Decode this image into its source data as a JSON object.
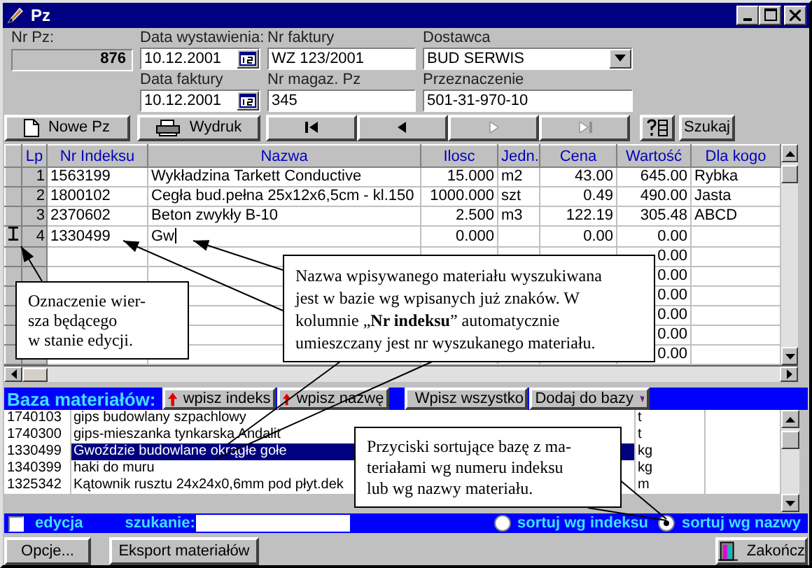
{
  "window": {
    "title": "Pz"
  },
  "nr_pz": {
    "label": "Nr Pz:",
    "value": "876"
  },
  "fields": [
    {
      "label": "Data wystawienia:",
      "value": "10.12.2001",
      "kind": "date"
    },
    {
      "label": "Nr faktury",
      "value": "WZ 123/2001",
      "kind": "text"
    },
    {
      "label": "Dostawca",
      "value": "BUD SERWIS",
      "kind": "combo"
    },
    {
      "label": "Data faktury",
      "value": "10.12.2001",
      "kind": "date"
    },
    {
      "label": "Nr magaz. Pz",
      "value": "345",
      "kind": "text"
    },
    {
      "label": "Przeznaczenie",
      "value": "501-31-970-10",
      "kind": "text"
    }
  ],
  "toolbar": [
    {
      "kind": "new",
      "label": "Nowe Pz"
    },
    {
      "kind": "print",
      "label": "Wydruk"
    },
    {
      "kind": "first",
      "disabled": false
    },
    {
      "kind": "prev",
      "disabled": false
    },
    {
      "kind": "next",
      "disabled": true
    },
    {
      "kind": "last",
      "disabled": true
    },
    {
      "kind": "list"
    },
    {
      "kind": "text",
      "label": "Szukaj"
    }
  ],
  "table": {
    "columns": [
      "Lp",
      "Nr Indeksu",
      "Nazwa",
      "Ilosc",
      "Jedn.",
      "Cena",
      "Wartość",
      "Dla kogo"
    ],
    "rows": [
      {
        "editing": false,
        "cells": [
          "1",
          "1563199",
          "Wykładzina Tarkett Conductive",
          "15.000",
          "m2",
          "43.00",
          "645.00",
          "Rybka"
        ]
      },
      {
        "editing": false,
        "cells": [
          "2",
          "1800102",
          "Cegła bud.pełna 25x12x6,5cm - kl.150",
          "1000.000",
          "szt",
          "0.49",
          "490.00",
          "Jasta"
        ]
      },
      {
        "editing": false,
        "cells": [
          "3",
          "2370602",
          "Beton zwykły B-10",
          "2.500",
          "m3",
          "122.19",
          "305.48",
          "ABCD"
        ]
      },
      {
        "editing": true,
        "cells": [
          "4",
          "1330499",
          "Gw",
          "0.000",
          "",
          "0.00",
          "0.00",
          ""
        ]
      },
      {
        "editing": false,
        "cells": [
          "",
          "",
          "",
          "",
          "",
          "",
          "0.00",
          ""
        ]
      },
      {
        "editing": false,
        "cells": [
          "",
          "",
          "",
          "",
          "",
          "",
          "0.00",
          ""
        ]
      },
      {
        "editing": false,
        "cells": [
          "",
          "",
          "",
          "",
          "",
          "",
          "0.00",
          ""
        ]
      },
      {
        "editing": false,
        "cells": [
          "",
          "",
          "",
          "",
          "",
          "",
          "0.00",
          ""
        ]
      },
      {
        "editing": false,
        "cells": [
          "",
          "",
          "",
          "",
          "",
          "",
          "0.00",
          ""
        ]
      },
      {
        "editing": false,
        "cells": [
          "",
          "",
          "",
          "",
          "",
          "",
          "0.00",
          ""
        ]
      }
    ]
  },
  "materials": {
    "title": "Baza materiałów:",
    "buttons": [
      {
        "kind": "up",
        "label": "wpisz indeks"
      },
      {
        "kind": "up",
        "label": "wpisz nazwę"
      },
      {
        "kind": "all",
        "label": "Wpisz wszystko"
      },
      {
        "kind": "add",
        "label": "Dodaj do bazy"
      }
    ],
    "rows": [
      {
        "index": "1740103",
        "name": "gips budowlany szpachlowy",
        "unit": "t",
        "selected": false
      },
      {
        "index": "1740300",
        "name": "gips-mieszanka tynkarska Andalit",
        "unit": "t",
        "selected": false
      },
      {
        "index": "1330499",
        "name": "Gwoździe budowlane okrągłe gołe",
        "unit": "kg",
        "selected": true
      },
      {
        "index": "1340399",
        "name": "haki do muru",
        "unit": "kg",
        "selected": false
      },
      {
        "index": "1325342",
        "name": "Kątownik rusztu 24x24x0,6mm pod płyt.dek",
        "unit": "m",
        "selected": false
      }
    ]
  },
  "search_bar": {
    "edit_label": "edycja",
    "edit_checked": false,
    "search_label": "szukanie:",
    "sort": [
      {
        "label": "sortuj wg indeksu",
        "selected": false
      },
      {
        "label": "sortuj wg nazwy",
        "selected": true
      }
    ]
  },
  "footer": [
    {
      "kind": "plain",
      "label": "Opcje..."
    },
    {
      "kind": "plain",
      "label": "Eksport materiałów"
    },
    {
      "kind": "exit",
      "label": "Zakończ"
    }
  ],
  "callouts": [
    {
      "text": "Oznaczenie wier-\nsza będącego\nw stanie edycji."
    },
    {
      "text": "Nazwa wpisywanego materiału wyszukiwana\njest w bazie wg wpisanych już znaków. W\nkolumnie „**Nr indeksu**” automatycznie\numieszczany jest nr wyszukanego materiału."
    },
    {
      "text": "Przyciski sortujące bazę z ma-\nteriałami wg numeru indeksu\nlub wg nazwy materiału."
    }
  ]
}
